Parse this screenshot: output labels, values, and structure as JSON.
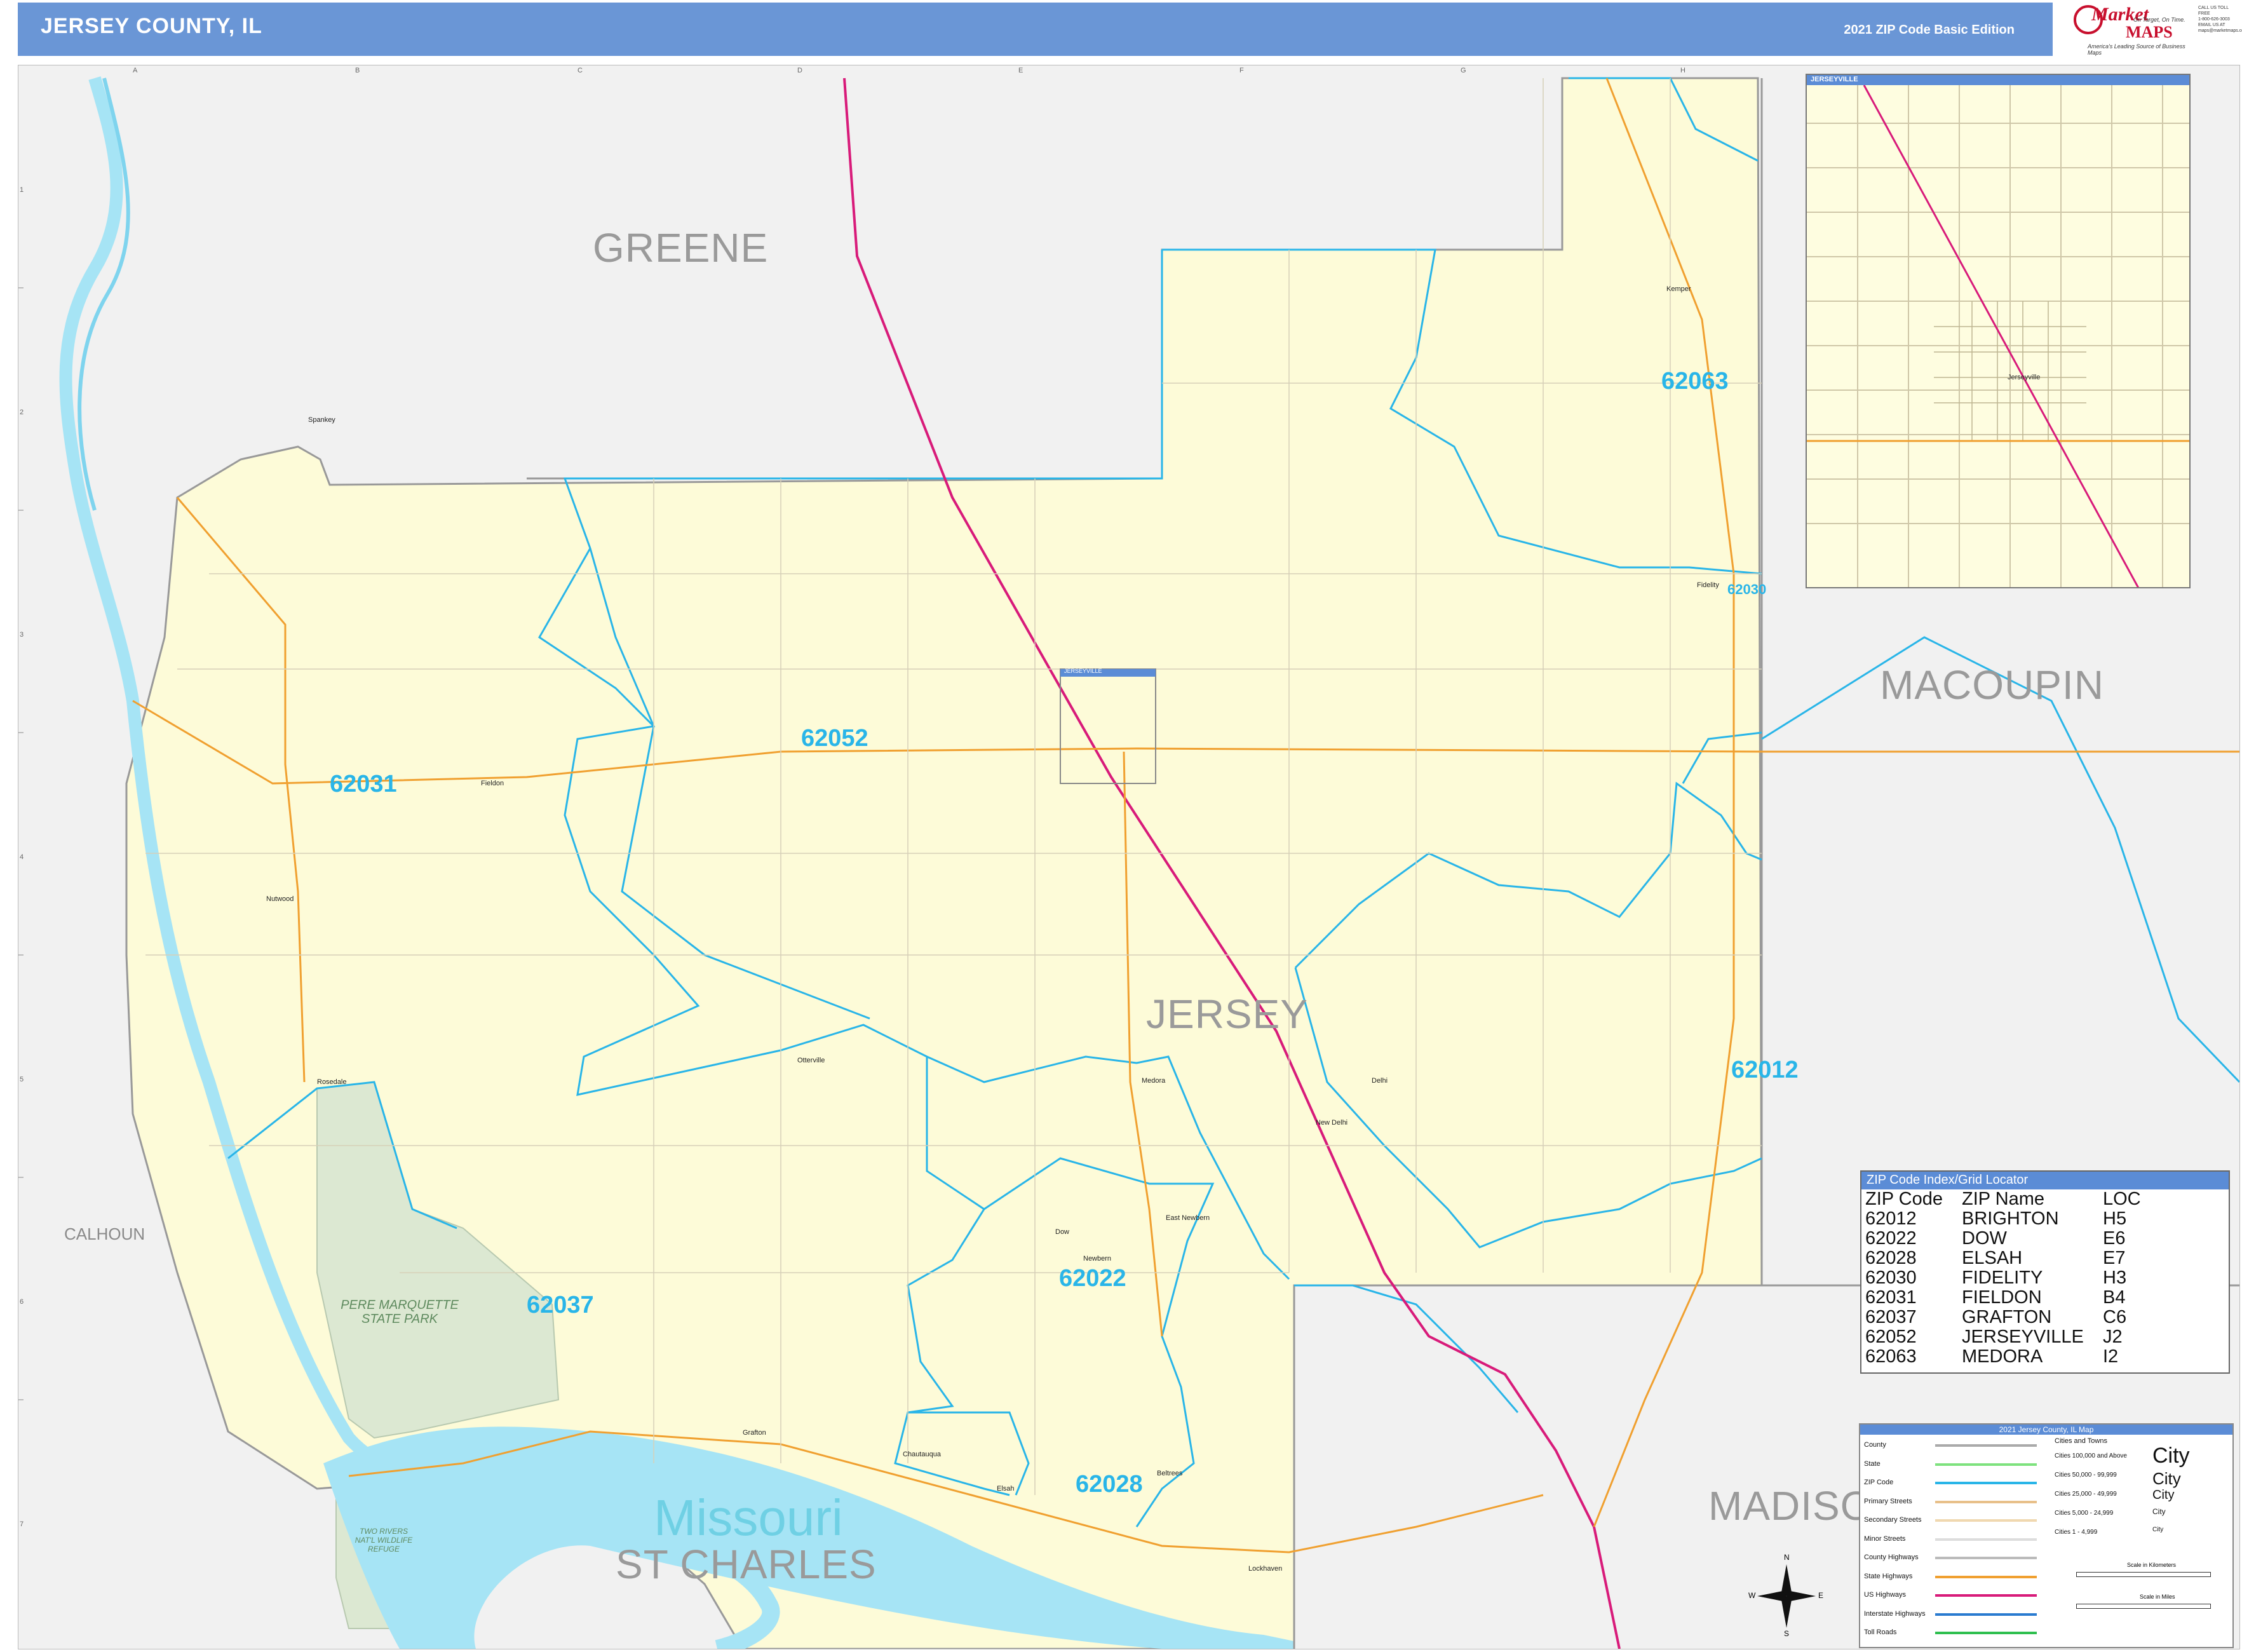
{
  "header": {
    "title": "JERSEY COUNTY, IL",
    "edition": "2021 ZIP Code Basic Edition",
    "logo_market": "Market",
    "logo_maps": "MAPS",
    "logo_tagline": "America's Leading Source of Business Maps",
    "logo_slogan": "On Target, On Time.",
    "contact": [
      "CALL US TOLL FREE",
      "1-800-626-3003",
      "EMAIL US AT",
      "maps@marketmaps.com"
    ]
  },
  "map": {
    "counties": [
      "GREENE",
      "MACOUPIN",
      "JERSEY",
      "MADISON",
      "ST CHARLES",
      "CALHOUN"
    ],
    "river": "Missouri",
    "park": "PERE MARQUETTE STATE PARK",
    "refuge": "TWO RIVERS NAT'L WILDLIFE REFUGE",
    "zip_labels": [
      "62063",
      "62030",
      "62052",
      "62031",
      "62012",
      "62037",
      "62022",
      "62028"
    ],
    "towns": [
      "Kemper",
      "Fidelity",
      "Fieldon",
      "Nutwood",
      "Rosedale",
      "Otterville",
      "Medora",
      "Delhi",
      "New Delhi",
      "Dow",
      "East Newbern",
      "Newbern",
      "Grafton",
      "Chautauqua",
      "Elsah",
      "Beltrees",
      "Lockhaven",
      "Spankey",
      "Jerseyville"
    ],
    "grid_cols": [
      "A",
      "B",
      "C",
      "D",
      "E",
      "F",
      "G",
      "H"
    ],
    "grid_rows": [
      "1",
      "2",
      "3",
      "4",
      "5",
      "6",
      "7"
    ],
    "inset_tag": "JERSEYVILLE"
  },
  "inset": {
    "title": "JERSEYVILLE",
    "town": "Jerseyville"
  },
  "zip_index": {
    "title": "ZIP Code Index/Grid Locator",
    "headers": [
      "ZIP Code",
      "ZIP Name",
      "LOC"
    ],
    "rows": [
      [
        "62012",
        "BRIGHTON",
        "H5"
      ],
      [
        "62022",
        "DOW",
        "E6"
      ],
      [
        "62028",
        "ELSAH",
        "E7"
      ],
      [
        "62030",
        "FIDELITY",
        "H3"
      ],
      [
        "62031",
        "FIELDON",
        "B4"
      ],
      [
        "62037",
        "GRAFTON",
        "C6"
      ],
      [
        "62052",
        "JERSEYVILLE",
        "J2"
      ],
      [
        "62063",
        "MEDORA",
        "I2"
      ]
    ]
  },
  "legend": {
    "title": "2021 Jersey County, IL Map",
    "items": [
      "County",
      "State",
      "ZIP Code",
      "Primary Streets",
      "Secondary Streets",
      "Minor Streets",
      "County Highways",
      "State Highways",
      "US Highways",
      "Interstate Highways",
      "Toll Roads"
    ],
    "colors": [
      "#aaaaaa",
      "#7ee27e",
      "#29b5e8",
      "#e8c08a",
      "#f0d8b0",
      "#dddddd",
      "#bbbbbb",
      "#f0a030",
      "#d81b7a",
      "#2a7bd0",
      "#2fbf4f"
    ],
    "cities_title": "Cities and Towns",
    "cities": [
      "Cities 100,000 and Above",
      "Cities 50,000 - 99,999",
      "Cities 25,000 - 49,999",
      "Cities 5,000 - 24,999",
      "Cities 1 - 4,999"
    ],
    "city_samples": [
      "City",
      "City",
      "City",
      "City",
      "City"
    ],
    "scale_km": "Scale in Kilometers",
    "scale_mi": "Scale in Miles"
  },
  "compass": {
    "n": "N",
    "s": "S",
    "e": "E",
    "w": "W"
  }
}
